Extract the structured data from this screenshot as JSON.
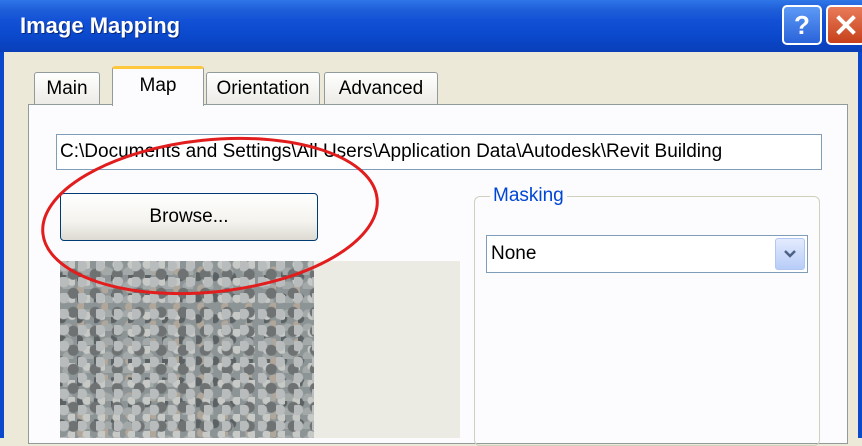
{
  "window": {
    "title": "Image Mapping",
    "help_label": "?",
    "colors": {
      "titlebar": "#0a48cc",
      "close": "#c6411b",
      "annotation": "#e11d1d",
      "group_label": "#0046d5"
    }
  },
  "tabs": [
    {
      "label": "Main",
      "active": false
    },
    {
      "label": "Map",
      "active": true
    },
    {
      "label": "Orientation",
      "active": false
    },
    {
      "label": "Advanced",
      "active": false
    }
  ],
  "map": {
    "path_value": "C:\\Documents and Settings\\All Users\\Application Data\\Autodesk\\Revit Building",
    "browse_label": "Browse...",
    "masking": {
      "group_label": "Masking",
      "selected": "None"
    }
  },
  "icons": {
    "help": "help-icon",
    "close": "close-icon",
    "dropdown": "chevron-down-icon"
  }
}
